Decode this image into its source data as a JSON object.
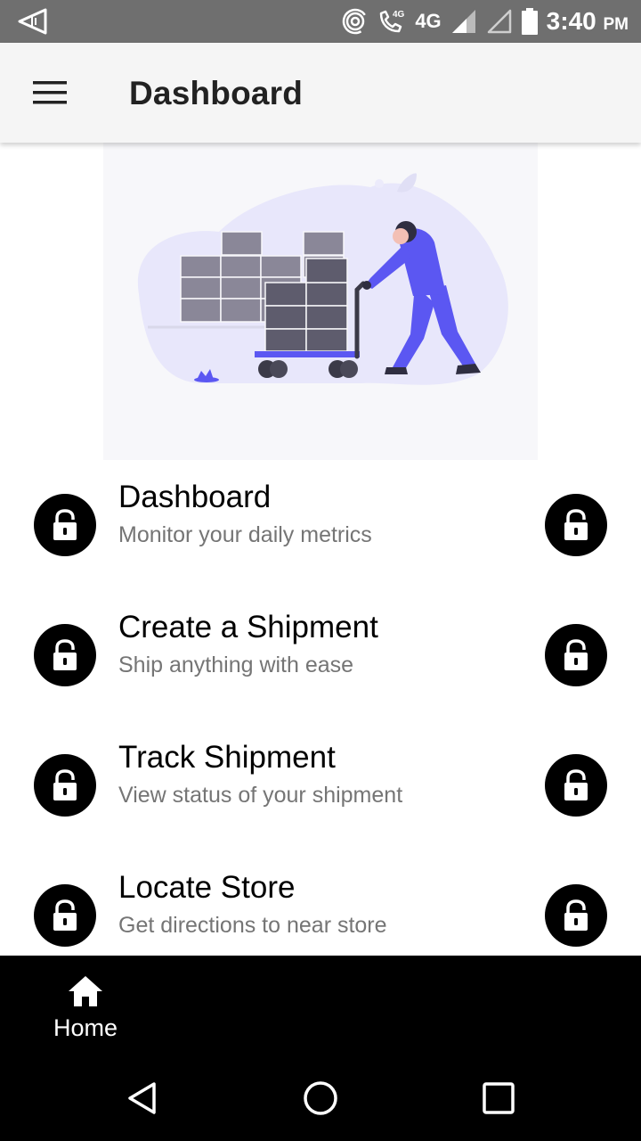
{
  "status_bar": {
    "network": "4G",
    "time": "3:40",
    "ampm": "PM",
    "icons": [
      "navigation-icon",
      "hotspot-icon",
      "volte-call-icon",
      "signal-icon",
      "signal-empty-icon",
      "battery-icon"
    ]
  },
  "app_bar": {
    "title": "Dashboard",
    "menu_icon": "hamburger-menu-icon"
  },
  "hero": {
    "illustration": "warehouse-worker-pushing-cart-illustration",
    "accent_color": "#5b57f2"
  },
  "features": [
    {
      "title": "Dashboard",
      "subtitle": "Monitor your daily metrics",
      "icon": "lock-open-icon"
    },
    {
      "title": "Create a Shipment",
      "subtitle": "Ship anything with ease",
      "icon": "lock-open-icon"
    },
    {
      "title": "Track Shipment",
      "subtitle": "View status of your shipment",
      "icon": "lock-open-icon"
    },
    {
      "title": "Locate Store",
      "subtitle": "Get directions to near store",
      "icon": "lock-open-icon"
    }
  ],
  "bottom_nav": {
    "home_label": "Home",
    "home_icon": "home-icon"
  },
  "system_nav": {
    "icons": [
      "back-icon",
      "home-circle-icon",
      "recents-icon"
    ]
  },
  "colors": {
    "status_bar": "#6f6f6f",
    "app_bar": "#f5f5f5",
    "bottom_nav": "#000000",
    "subtitle": "#757575"
  }
}
